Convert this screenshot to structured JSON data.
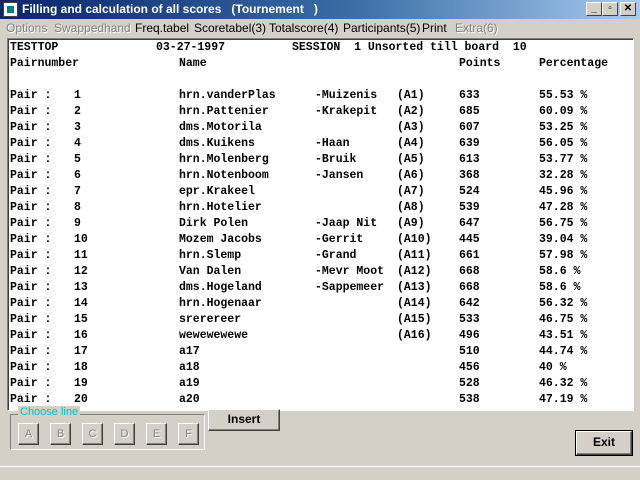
{
  "window": {
    "title": "Filling and calculation of all scores   (Tournement   )",
    "minimize_glyph": "_",
    "maximize_glyph": "▫",
    "close_glyph": "✕"
  },
  "menu": {
    "items": [
      {
        "label": "Options",
        "enabled": false
      },
      {
        "label": "Swappedhand",
        "enabled": false
      },
      {
        "label": "Freq.tabel",
        "enabled": true
      },
      {
        "label": "Scoretabel(3)",
        "enabled": true
      },
      {
        "label": "Totalscore(4)",
        "enabled": true
      },
      {
        "label": "Participants(5)",
        "enabled": true
      },
      {
        "label": "Print",
        "enabled": true
      },
      {
        "label": "Extra(6)",
        "enabled": false
      }
    ]
  },
  "header": {
    "club": "TESTTOP",
    "date": "03-27-1997",
    "session": "SESSION  1 Unsorted till board  10",
    "col_pair": "Pairnumber",
    "col_name": "Name",
    "col_points": "Points",
    "col_percentage": "Percentage"
  },
  "rows": [
    {
      "label": "Pair :",
      "num": "1",
      "name": "hrn.vanderPlas",
      "partner": "-Muizenis",
      "code": "(A1)",
      "points": "633",
      "pct": "55.53 %"
    },
    {
      "label": "Pair :",
      "num": "2",
      "name": "hrn.Pattenier",
      "partner": "-Krakepit",
      "code": "(A2)",
      "points": "685",
      "pct": "60.09 %"
    },
    {
      "label": "Pair :",
      "num": "3",
      "name": "dms.Motorila",
      "partner": "",
      "code": "(A3)",
      "points": "607",
      "pct": "53.25 %"
    },
    {
      "label": "Pair :",
      "num": "4",
      "name": "dms.Kuikens",
      "partner": "-Haan",
      "code": "(A4)",
      "points": "639",
      "pct": "56.05 %"
    },
    {
      "label": "Pair :",
      "num": "5",
      "name": "hrn.Molenberg",
      "partner": "-Bruik",
      "code": "(A5)",
      "points": "613",
      "pct": "53.77 %"
    },
    {
      "label": "Pair :",
      "num": "6",
      "name": "hrn.Notenboom",
      "partner": "-Jansen",
      "code": "(A6)",
      "points": "368",
      "pct": "32.28 %"
    },
    {
      "label": "Pair :",
      "num": "7",
      "name": "epr.Krakeel",
      "partner": "",
      "code": "(A7)",
      "points": "524",
      "pct": "45.96 %"
    },
    {
      "label": "Pair :",
      "num": "8",
      "name": "hrn.Hotelier",
      "partner": "",
      "code": "(A8)",
      "points": "539",
      "pct": "47.28 %"
    },
    {
      "label": "Pair :",
      "num": "9",
      "name": "Dirk Polen",
      "partner": "-Jaap Nit",
      "code": "(A9)",
      "points": "647",
      "pct": "56.75 %"
    },
    {
      "label": "Pair :",
      "num": "10",
      "name": "Mozem Jacobs",
      "partner": "-Gerrit",
      "code": "(A10)",
      "points": "445",
      "pct": "39.04 %"
    },
    {
      "label": "Pair :",
      "num": "11",
      "name": "hrn.Slemp",
      "partner": "-Grand",
      "code": "(A11)",
      "points": "661",
      "pct": "57.98 %"
    },
    {
      "label": "Pair :",
      "num": "12",
      "name": "Van Dalen",
      "partner": "-Mevr Moot",
      "code": "(A12)",
      "points": "668",
      "pct": "58.6 %"
    },
    {
      "label": "Pair :",
      "num": "13",
      "name": "dms.Hogeland",
      "partner": "-Sappemeer",
      "code": "(A13)",
      "points": "668",
      "pct": "58.6 %"
    },
    {
      "label": "Pair :",
      "num": "14",
      "name": "hrn.Hogenaar",
      "partner": "",
      "code": "(A14)",
      "points": "642",
      "pct": "56.32 %"
    },
    {
      "label": "Pair :",
      "num": "15",
      "name": "srerereer",
      "partner": "",
      "code": "(A15)",
      "points": "533",
      "pct": "46.75 %"
    },
    {
      "label": "Pair :",
      "num": "16",
      "name": "wewewewewe",
      "partner": "",
      "code": "(A16)",
      "points": "496",
      "pct": "43.51 %"
    },
    {
      "label": "Pair :",
      "num": "17",
      "name": "a17",
      "partner": "",
      "code": "",
      "points": "510",
      "pct": "44.74 %"
    },
    {
      "label": "Pair :",
      "num": "18",
      "name": "a18",
      "partner": "",
      "code": "",
      "points": "456",
      "pct": "40 %"
    },
    {
      "label": "Pair :",
      "num": "19",
      "name": "a19",
      "partner": "",
      "code": "",
      "points": "528",
      "pct": "46.32 %"
    },
    {
      "label": "Pair :",
      "num": "20",
      "name": "a20",
      "partner": "",
      "code": "",
      "points": "538",
      "pct": "47.19 %"
    }
  ],
  "bottom": {
    "choose_line_label": "Choose line",
    "line_buttons": [
      "A",
      "B",
      "C",
      "D",
      "E",
      "F"
    ],
    "insert_label": "Insert",
    "exit_label": "Exit"
  }
}
